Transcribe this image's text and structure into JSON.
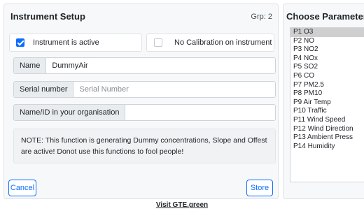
{
  "setup": {
    "title": "Instrument Setup",
    "group": "Grp: 2",
    "active_label": "Instrument is active",
    "active_checked": true,
    "nocal_label": "No Calibration on instrument",
    "nocal_checked": false,
    "name_label": "Name",
    "name_value": "DummyAir",
    "serial_label": "Serial number",
    "serial_placeholder": "Serial Number",
    "serial_value": "",
    "orgid_label": "Name/ID in your organisation",
    "orgid_value": "",
    "note": "NOTE: This function is generating Dummy concentrations, Slope and Offest are active! Donot use this functions to fool people!",
    "cancel_label": "Cancel",
    "store_label": "Store"
  },
  "parameters": {
    "title": "Choose Parameter",
    "items": [
      "P1 O3",
      "P2 NO",
      "P3 NO2",
      "P4 NOx",
      "P5 SO2",
      "P6 CO",
      "P7 PM2.5",
      "P8 PM10",
      "P9 Air Temp",
      "P10 Traffic",
      "P11 Wind Speed",
      "P12 Wind Direction",
      "P13 Ambient Press",
      "P14 Humidity"
    ],
    "selected_index": 0
  },
  "footer": {
    "link": "Visit GTE.green"
  },
  "colors": {
    "accent": "#0d6efd",
    "selected_bg": "#cfcfcf"
  }
}
